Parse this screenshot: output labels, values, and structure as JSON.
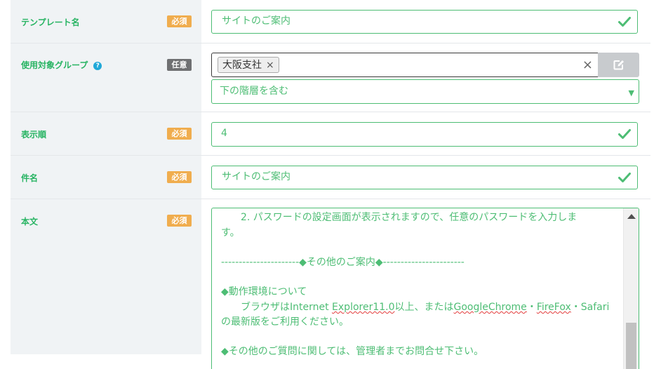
{
  "form": {
    "template_name": {
      "label": "テンプレート名",
      "badge": "必須",
      "value": "サイトのご案内"
    },
    "target_group": {
      "label": "使用対象グループ",
      "help_icon": "?",
      "badge": "任意",
      "tag_label": "大阪支社",
      "tag_remove": "×",
      "clear": "×",
      "scope_select": "下の階層を含む"
    },
    "display_order": {
      "label": "表示順",
      "badge": "必須",
      "value": "4"
    },
    "subject": {
      "label": "件名",
      "badge": "必須",
      "value": "サイトのご案内"
    },
    "body": {
      "label": "本文",
      "badge": "必須",
      "line1": "　　2. パスワードの設定画面が表示されますので、任意のパスワードを入力しま",
      "line2": "す。",
      "line3": "----------------------◆その他のご案内◆-----------------------",
      "line4": "◆動作環境について",
      "line5_a": "　　ブラウザは",
      "line5_b": "Internet",
      "line5_c": " ",
      "line5_d": "Explorer11.0",
      "line5_e": "以上、または",
      "line5_f": "GoogleChrome",
      "line5_g": "・",
      "line5_h": "FireFox",
      "line5_i": "・Safari",
      "line6": "の最新版をご利用ください。",
      "line7": "◆その他のご質問に関しては、管理者までお問合せ下さい。"
    }
  },
  "icons": {
    "valid": "checkmark-icon",
    "edit": "edit-icon",
    "help": "question-circle-icon",
    "caret": "caret-down-icon"
  },
  "colors": {
    "valid_green": "#4dbd74",
    "label_green": "#28b463",
    "required_badge": "#f0ad4e",
    "optional_badge": "#6f7072",
    "label_bg": "#f0f3f5"
  }
}
